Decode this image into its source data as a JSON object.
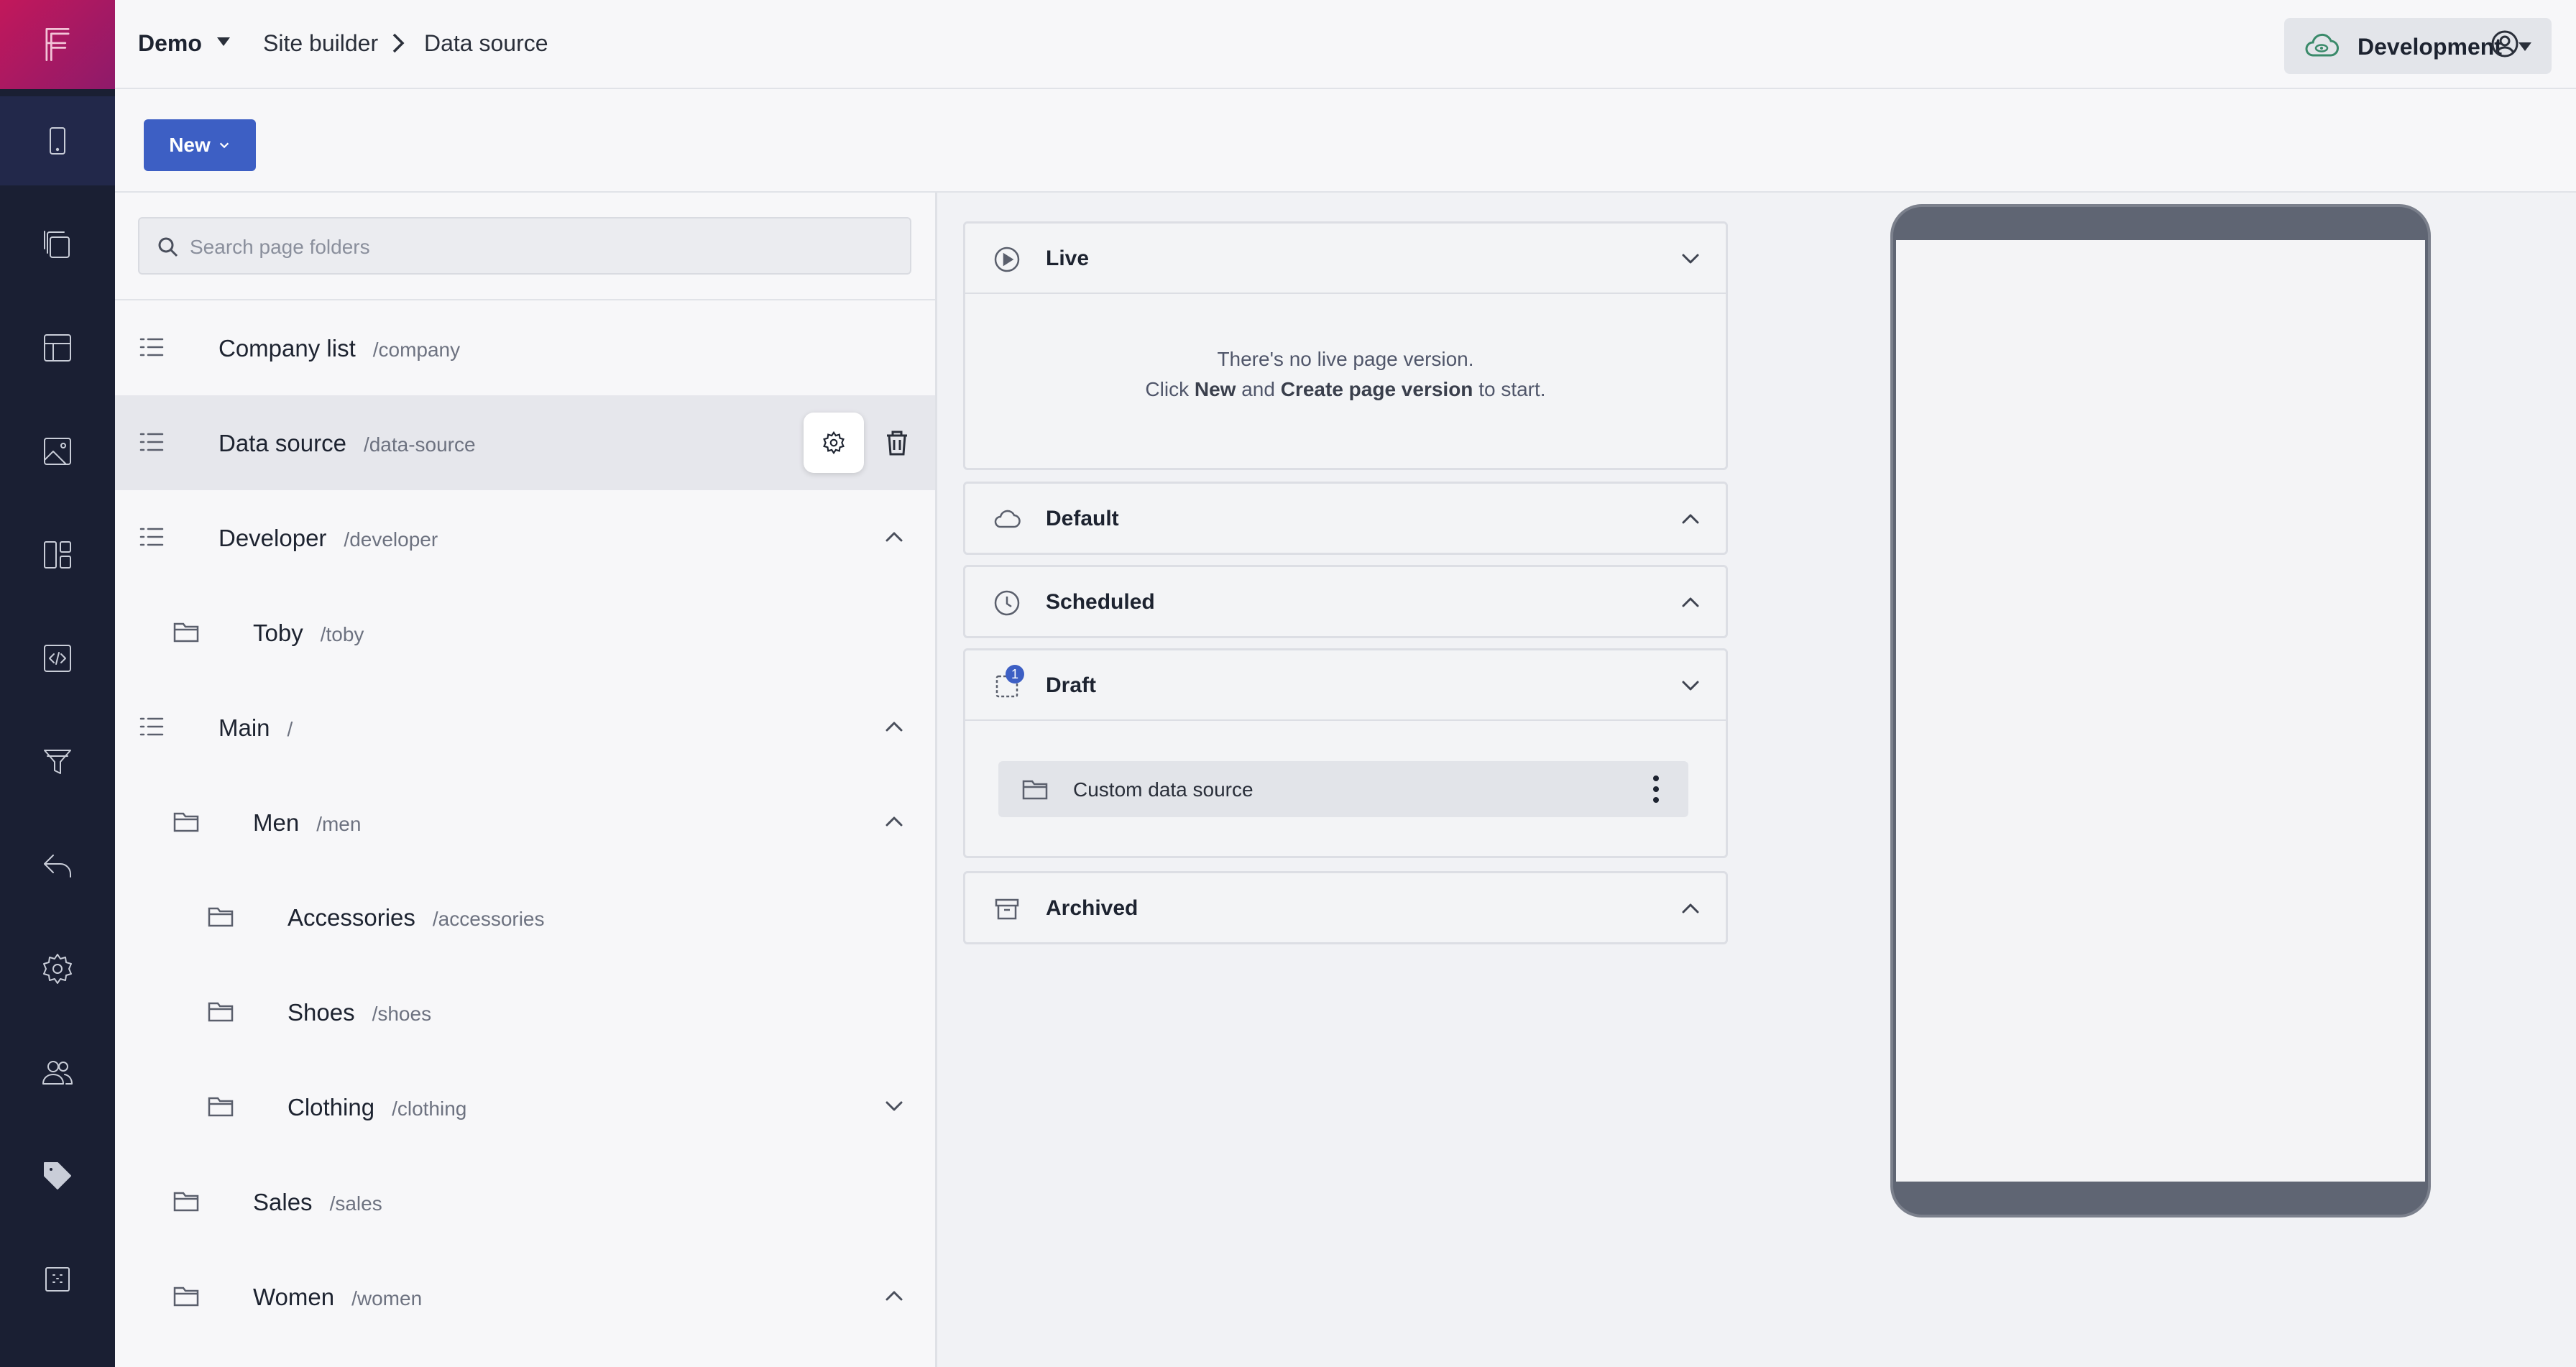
{
  "rail": {
    "items": [
      {
        "icon": "mobile-icon",
        "active": true
      },
      {
        "icon": "pages-icon"
      },
      {
        "icon": "layout-icon"
      },
      {
        "icon": "image-icon"
      },
      {
        "icon": "components-icon"
      },
      {
        "icon": "code-icon"
      },
      {
        "icon": "filter-icon"
      },
      {
        "icon": "undo-icon"
      },
      {
        "icon": "gear-icon"
      },
      {
        "icon": "users-icon"
      },
      {
        "icon": "tag-icon"
      },
      {
        "icon": "apps-icon"
      }
    ]
  },
  "header": {
    "workspace": "Demo",
    "breadcrumb": [
      "Site builder",
      "Data source"
    ],
    "environment": "Development"
  },
  "toolbar": {
    "new_label": "New"
  },
  "tree": {
    "search_placeholder": "Search page folders",
    "rows": [
      {
        "name": "Company list",
        "path": "/company",
        "type": "list"
      },
      {
        "name": "Data source",
        "path": "/data-source",
        "type": "list",
        "selected": true
      },
      {
        "name": "Developer",
        "path": "/developer",
        "type": "list",
        "chevron": "up"
      },
      {
        "name": "Toby",
        "path": "/toby",
        "type": "folder"
      },
      {
        "name": "Main",
        "path": "/",
        "type": "list",
        "chevron": "up"
      },
      {
        "name": "Men",
        "path": "/men",
        "type": "folder",
        "chevron": "up"
      },
      {
        "name": "Accessories",
        "path": "/accessories",
        "type": "folder"
      },
      {
        "name": "Shoes",
        "path": "/shoes",
        "type": "folder"
      },
      {
        "name": "Clothing",
        "path": "/clothing",
        "type": "folder",
        "chevron": "down"
      },
      {
        "name": "Sales",
        "path": "/sales",
        "type": "folder"
      },
      {
        "name": "Women",
        "path": "/women",
        "type": "folder",
        "chevron": "up"
      }
    ]
  },
  "versions": {
    "live": {
      "title": "Live",
      "empty_line1": "There's no live page version.",
      "empty_click": "Click",
      "empty_new": "New",
      "empty_and": "and",
      "empty_create": "Create page version",
      "empty_tail": "to start."
    },
    "default": {
      "title": "Default"
    },
    "scheduled": {
      "title": "Scheduled"
    },
    "draft": {
      "title": "Draft",
      "badge": "1",
      "item": "Custom data source"
    },
    "archived": {
      "title": "Archived"
    }
  },
  "colors": {
    "rail": "#1a1f33",
    "brand": "#c2185b",
    "accent": "#3d5fc4"
  }
}
